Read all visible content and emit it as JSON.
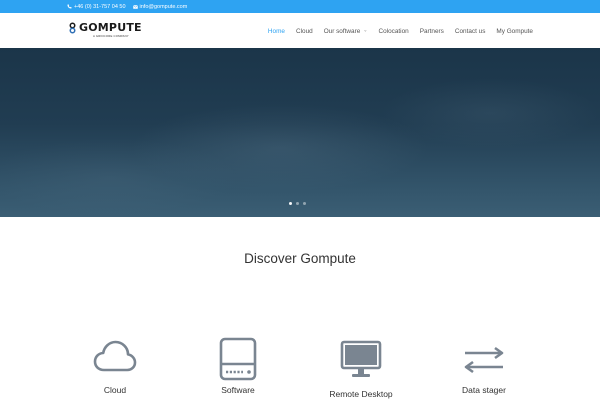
{
  "topbar": {
    "phone": "+46 (0) 31-757 04 50",
    "email": "info@gompute.com",
    "color": "#2ea3f2"
  },
  "header": {
    "logo_text": "GOMPUTE",
    "logo_subtext": "A Gridcore company"
  },
  "nav": {
    "items": [
      {
        "label": "Home",
        "active": true
      },
      {
        "label": "Cloud"
      },
      {
        "label": "Our software",
        "has_dropdown": true
      },
      {
        "label": "Colocation"
      },
      {
        "label": "Partners"
      },
      {
        "label": "Contact us"
      },
      {
        "label": "My Gompute"
      }
    ],
    "active_color": "#2ea3f2"
  },
  "hero": {
    "slides": 3,
    "active_slide": 1
  },
  "section": {
    "title": "Discover Gompute"
  },
  "features": [
    {
      "label": "Cloud",
      "icon": "cloud-icon"
    },
    {
      "label": "Software",
      "icon": "hard-drive-icon"
    },
    {
      "label": "Remote Desktop",
      "icon": "monitor-icon"
    },
    {
      "label": "Data stager",
      "icon": "transfer-arrows-icon"
    }
  ],
  "icon_color": "#7a8591"
}
